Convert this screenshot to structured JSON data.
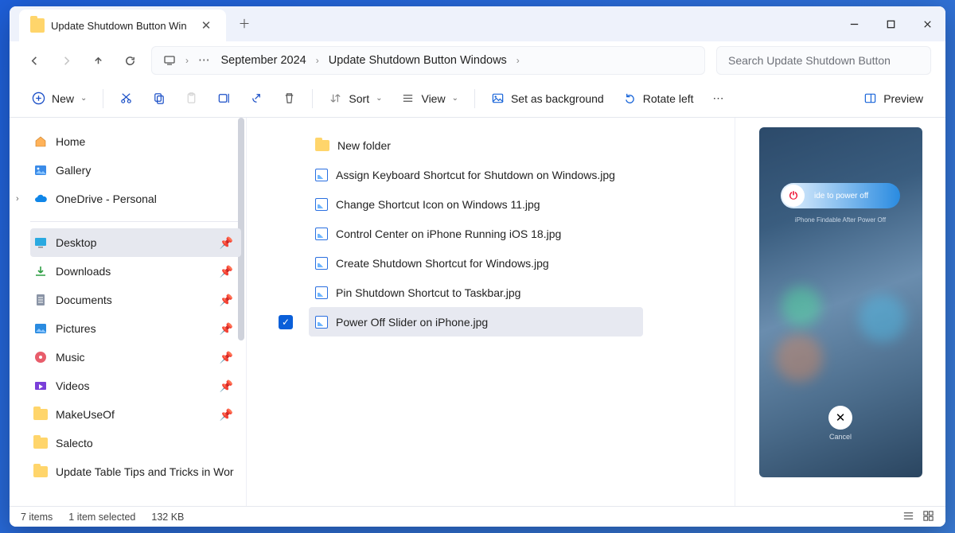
{
  "tab": {
    "title": "Update Shutdown Button Win"
  },
  "breadcrumb": {
    "seg1": "September 2024",
    "seg2": "Update Shutdown Button Windows"
  },
  "search": {
    "placeholder": "Search Update Shutdown Button"
  },
  "toolbar": {
    "new": "New",
    "sort": "Sort",
    "view": "View",
    "background": "Set as background",
    "rotate": "Rotate left",
    "preview": "Preview"
  },
  "sidebar": {
    "home": "Home",
    "gallery": "Gallery",
    "onedrive": "OneDrive - Personal",
    "desktop": "Desktop",
    "downloads": "Downloads",
    "documents": "Documents",
    "pictures": "Pictures",
    "music": "Music",
    "videos": "Videos",
    "makeuseof": "MakeUseOf",
    "salecto": "Salecto",
    "tips": "Update Table Tips and Tricks in Wor"
  },
  "files": {
    "f0": "New folder",
    "f1": "Assign Keyboard Shortcut for Shutdown on Windows.jpg",
    "f2": "Change Shortcut Icon on Windows 11.jpg",
    "f3": "Control Center on iPhone Running iOS 18.jpg",
    "f4": "Create Shutdown Shortcut for Windows.jpg",
    "f5": "Pin Shutdown Shortcut to Taskbar.jpg",
    "f6": "Power Off Slider on iPhone.jpg"
  },
  "previewPhone": {
    "slideText": "ide to power off",
    "findable": "iPhone Findable After Power Off",
    "cancel": "Cancel"
  },
  "status": {
    "count": "7 items",
    "selected": "1 item selected",
    "size": "132 KB"
  }
}
